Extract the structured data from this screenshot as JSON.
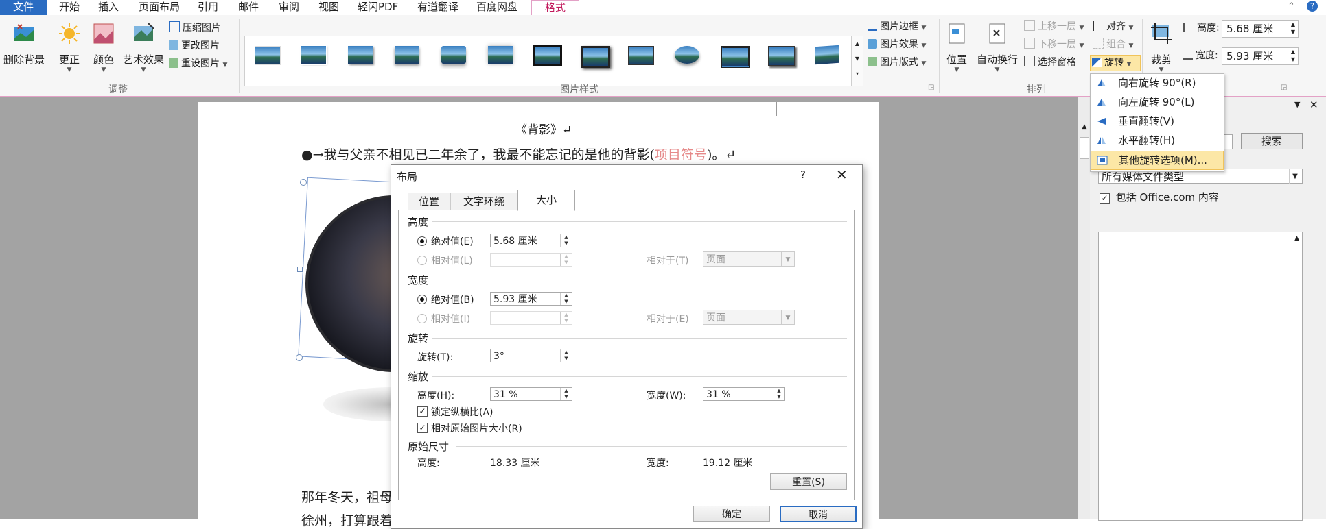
{
  "menu": {
    "tabs": [
      "文件",
      "开始",
      "插入",
      "页面布局",
      "引用",
      "邮件",
      "审阅",
      "视图",
      "轻闪PDF",
      "有道翻译",
      "百度网盘",
      "格式"
    ]
  },
  "ribbon": {
    "adjust": {
      "remove_bg": "删除背景",
      "correct": "更正",
      "color": "颜色",
      "art_effect": "艺术效果",
      "compress": "压缩图片",
      "change_pic": "更改图片",
      "reset_pic": "重设图片",
      "group_label": "调整"
    },
    "styles": {
      "group_label": "图片样式",
      "border": "图片边框",
      "effect": "图片效果",
      "layout": "图片版式"
    },
    "arrange": {
      "position": "位置",
      "wrap": "自动换行",
      "bring_forward": "上移一层",
      "send_backward": "下移一层",
      "selection_pane": "选择窗格",
      "align": "对齐",
      "group": "组合",
      "rotate": "旋转",
      "group_label": "排列"
    },
    "size": {
      "crop": "裁剪",
      "height_label": "高度:",
      "height_value": "5.68 厘米",
      "width_label": "宽度:",
      "width_value": "5.93 厘米"
    }
  },
  "rotate_menu": {
    "items": [
      "向右旋转 90°(R)",
      "向左旋转 90°(L)",
      "垂直翻转(V)",
      "水平翻转(H)",
      "其他旋转选项(M)..."
    ]
  },
  "document": {
    "title": "《背影》↵",
    "bullet_line": "●→我与父亲不相见已二年余了，我最不能忘记的是他的背影(",
    "bullet_note": "项目符号",
    "bullet_end": ")。↵",
    "para_start": "那年冬天，祖母",
    "para2": "徐州，打算跟着"
  },
  "right_pane": {
    "search_button": "搜索",
    "media_type": "所有媒体文件类型",
    "include_office": "包括 Office.com 内容"
  },
  "dialog": {
    "title": "布局",
    "help": "?",
    "tabs": [
      "位置",
      "文字环绕",
      "大小"
    ],
    "height": {
      "section": "高度",
      "absolute_label": "绝对值(E)",
      "absolute_value": "5.68 厘米",
      "relative_label": "相对值(L)",
      "relative_to_label": "相对于(T)",
      "relative_to_value": "页面"
    },
    "width": {
      "section": "宽度",
      "absolute_label": "绝对值(B)",
      "absolute_value": "5.93 厘米",
      "relative_label": "相对值(I)",
      "relative_to_label": "相对于(E)",
      "relative_to_value": "页面"
    },
    "rotation": {
      "section": "旋转",
      "label": "旋转(T):",
      "value": "3°"
    },
    "scale": {
      "section": "缩放",
      "height_label": "高度(H):",
      "height_value": "31 %",
      "width_label": "宽度(W):",
      "width_value": "31 %",
      "lock_ratio": "锁定纵横比(A)",
      "relative_original": "相对原始图片大小(R)"
    },
    "original": {
      "section": "原始尺寸",
      "height_label": "高度:",
      "height_value": "18.33 厘米",
      "width_label": "宽度:",
      "width_value": "19.12 厘米"
    },
    "reset": "重置(S)",
    "ok": "确定",
    "cancel": "取消"
  }
}
